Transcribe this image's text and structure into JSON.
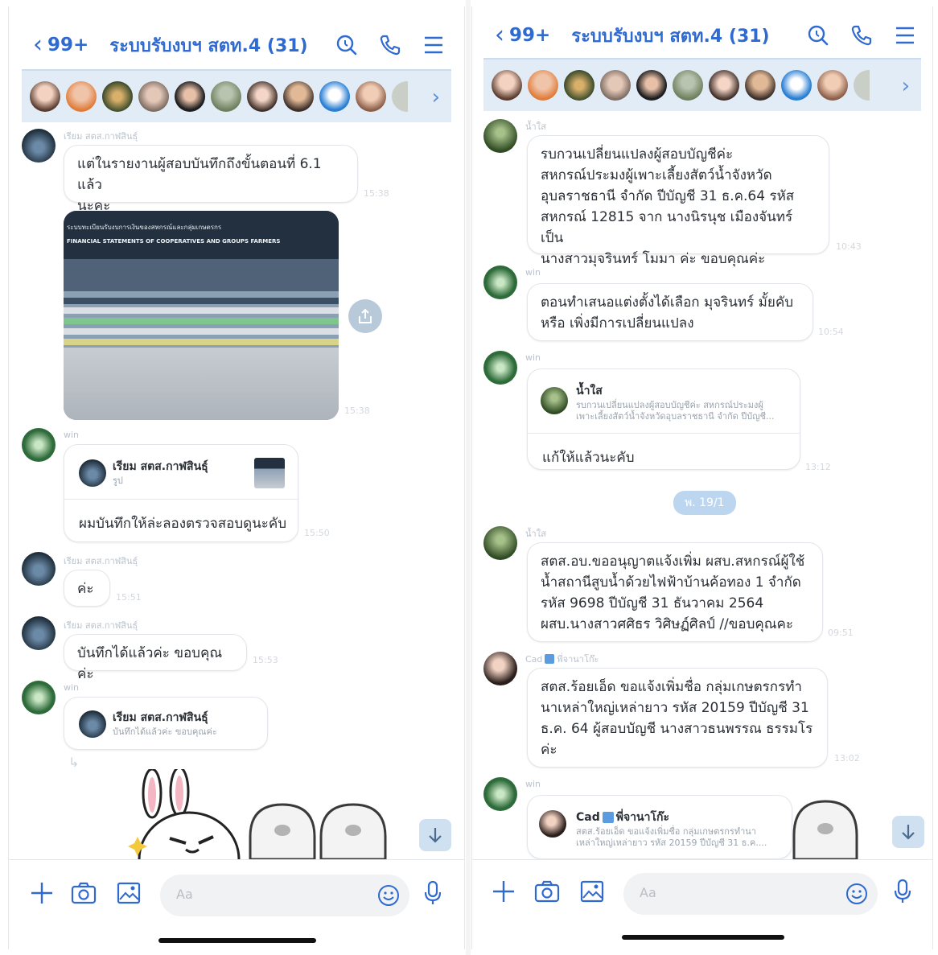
{
  "header": {
    "back_count": "99+",
    "title": "ระบบรับงบฯ สตท.4 (31)"
  },
  "colors": {
    "accent": "#2f6ad0",
    "member_bar": "#e1ecf7",
    "bubble_border": "#e2e6ea",
    "time_text": "#d3d8de"
  },
  "icons": {
    "back": "chevron-left-icon",
    "search": "search-icon",
    "call": "phone-icon",
    "menu": "hamburger-menu-icon",
    "more_members": "chevron-right-icon",
    "add": "plus-icon",
    "camera": "camera-icon",
    "gallery": "image-icon",
    "emoji": "emoji-icon",
    "voice": "microphone-icon",
    "share": "share-icon",
    "scroll_down": "arrow-down-icon"
  },
  "input": {
    "placeholder": "Aa"
  },
  "left_chat": {
    "m1": {
      "sender": "เรียม สตส.กาฬสินธุ์",
      "line1": "แต่ในรายงานผู้สอบบันทึกถึงขั้นตอนที่ 6.1 แล้ว",
      "line2": "นะคะ",
      "time": "15:38"
    },
    "m2": {
      "sender": "",
      "time": "15:38",
      "shot_header": "ระบบทะเบียนรับงบการเงินของสหกรณ์และกลุ่มเกษตรกร",
      "shot_sub": "FINANCIAL STATEMENTS OF COOPERATIVES AND GROUPS FARMERS"
    },
    "m3": {
      "sender": "win",
      "quote_name": "เรียม สตส.กาฬสินธุ์",
      "quote_sub": "รูป",
      "text": "ผมบันทึกให้ล่ะลองตรวจสอบดูนะคับ",
      "time": "15:50"
    },
    "m4": {
      "sender": "เรียม สตส.กาฬสินธุ์",
      "text": "ค่ะ",
      "time": "15:51"
    },
    "m5": {
      "sender": "เรียม สตส.กาฬสินธุ์",
      "text": "บันทึกได้แล้วค่ะ ขอบคุณค่ะ",
      "time": "15:53"
    },
    "m6": {
      "sender": "win",
      "quote_name": "เรียม สตส.กาฬสินธุ์",
      "quote_sub": "บันทึกได้แล้วค่ะ ขอบคุณค่ะ"
    }
  },
  "right_chat": {
    "m1": {
      "sender": "น้ำใส",
      "lines": [
        "รบกวนเปลี่ยนแปลงผู้สอบบัญชีค่ะ",
        "สหกรณ์ประมงผู้เพาะเลี้ยงสัตว์น้ำจังหวัด",
        "อุบลราชธานี จำกัด ปีบัญชี 31 ธ.ค.64  รหัส",
        "สหกรณ์ 12815 จาก นางนิรนุช  เมืองจันทร์ เป็น",
        "นางสาวมุจรินทร์  โมมา ค่ะ      ขอบคุณค่ะ"
      ],
      "time": "10:43"
    },
    "m2": {
      "sender": "win",
      "lines": [
        "ตอนทำเสนอแต่งตั้งได้เลือก มุจรินทร์ มั้ยคับ",
        "หรือ เพิ่งมีการเปลี่ยนแปลง"
      ],
      "time": "10:54"
    },
    "m3": {
      "sender": "win",
      "quote_name": "น้ำใส",
      "quote_sub1": "รบกวนเปลี่ยนแปลงผู้สอบบัญชีค่ะ สหกรณ์ประมงผู้",
      "quote_sub2": "เพาะเลี้ยงสัตว์น้ำจังหวัดอุบลราชธานี จำกัด ปีบัญชี...",
      "text": "แก้ให้แล้วนะคับ",
      "time": "13:12"
    },
    "date": "พ. 19/1",
    "m4": {
      "sender": "น้ำใส",
      "lines": [
        "สตส.อบ.ขออนุญาตแจ้งเพิ่ม ผสบ.สหกรณ์ผู้ใช้",
        "น้ำสถานีสูบน้ำด้วยไฟฟ้าบ้านค้อทอง 1 จำกัด",
        "รหัส 9698 ปีบัญชี 31 ธันวาคม 2564",
        "ผสบ.นางสาวศศิธร  วิศิษฏ์ศิลป์ //ขอบคุณคะ"
      ],
      "time": "09:51"
    },
    "m5": {
      "sender_name": "Cad",
      "sender_badge": "พี่จานาโก๊ะ",
      "lines": [
        "สตส.ร้อยเอ็ด ขอแจ้งเพิ่มชื่อ กลุ่มเกษตรกรทำ",
        "นาเหล่าใหญ่เหล่ายาว รหัส 20159 ปีบัญชี 31",
        "ธ.ค. 64 ผู้สอบบัญชี นางสาวธนพรรณ ธรรมโร",
        "ค่ะ"
      ],
      "time": "13:02"
    },
    "m6": {
      "sender": "win",
      "quote_name": "Cad",
      "quote_badge": "พี่จานาโก๊ะ",
      "quote_sub1": "สตส.ร้อยเอ็ด ขอแจ้งเพิ่มชื่อ กลุ่มเกษตรกรทำนา",
      "quote_sub2": "เหล่าใหญ่เหล่ายาว รหัส 20159 ปีบัญชี 31 ธ.ค...."
    }
  }
}
